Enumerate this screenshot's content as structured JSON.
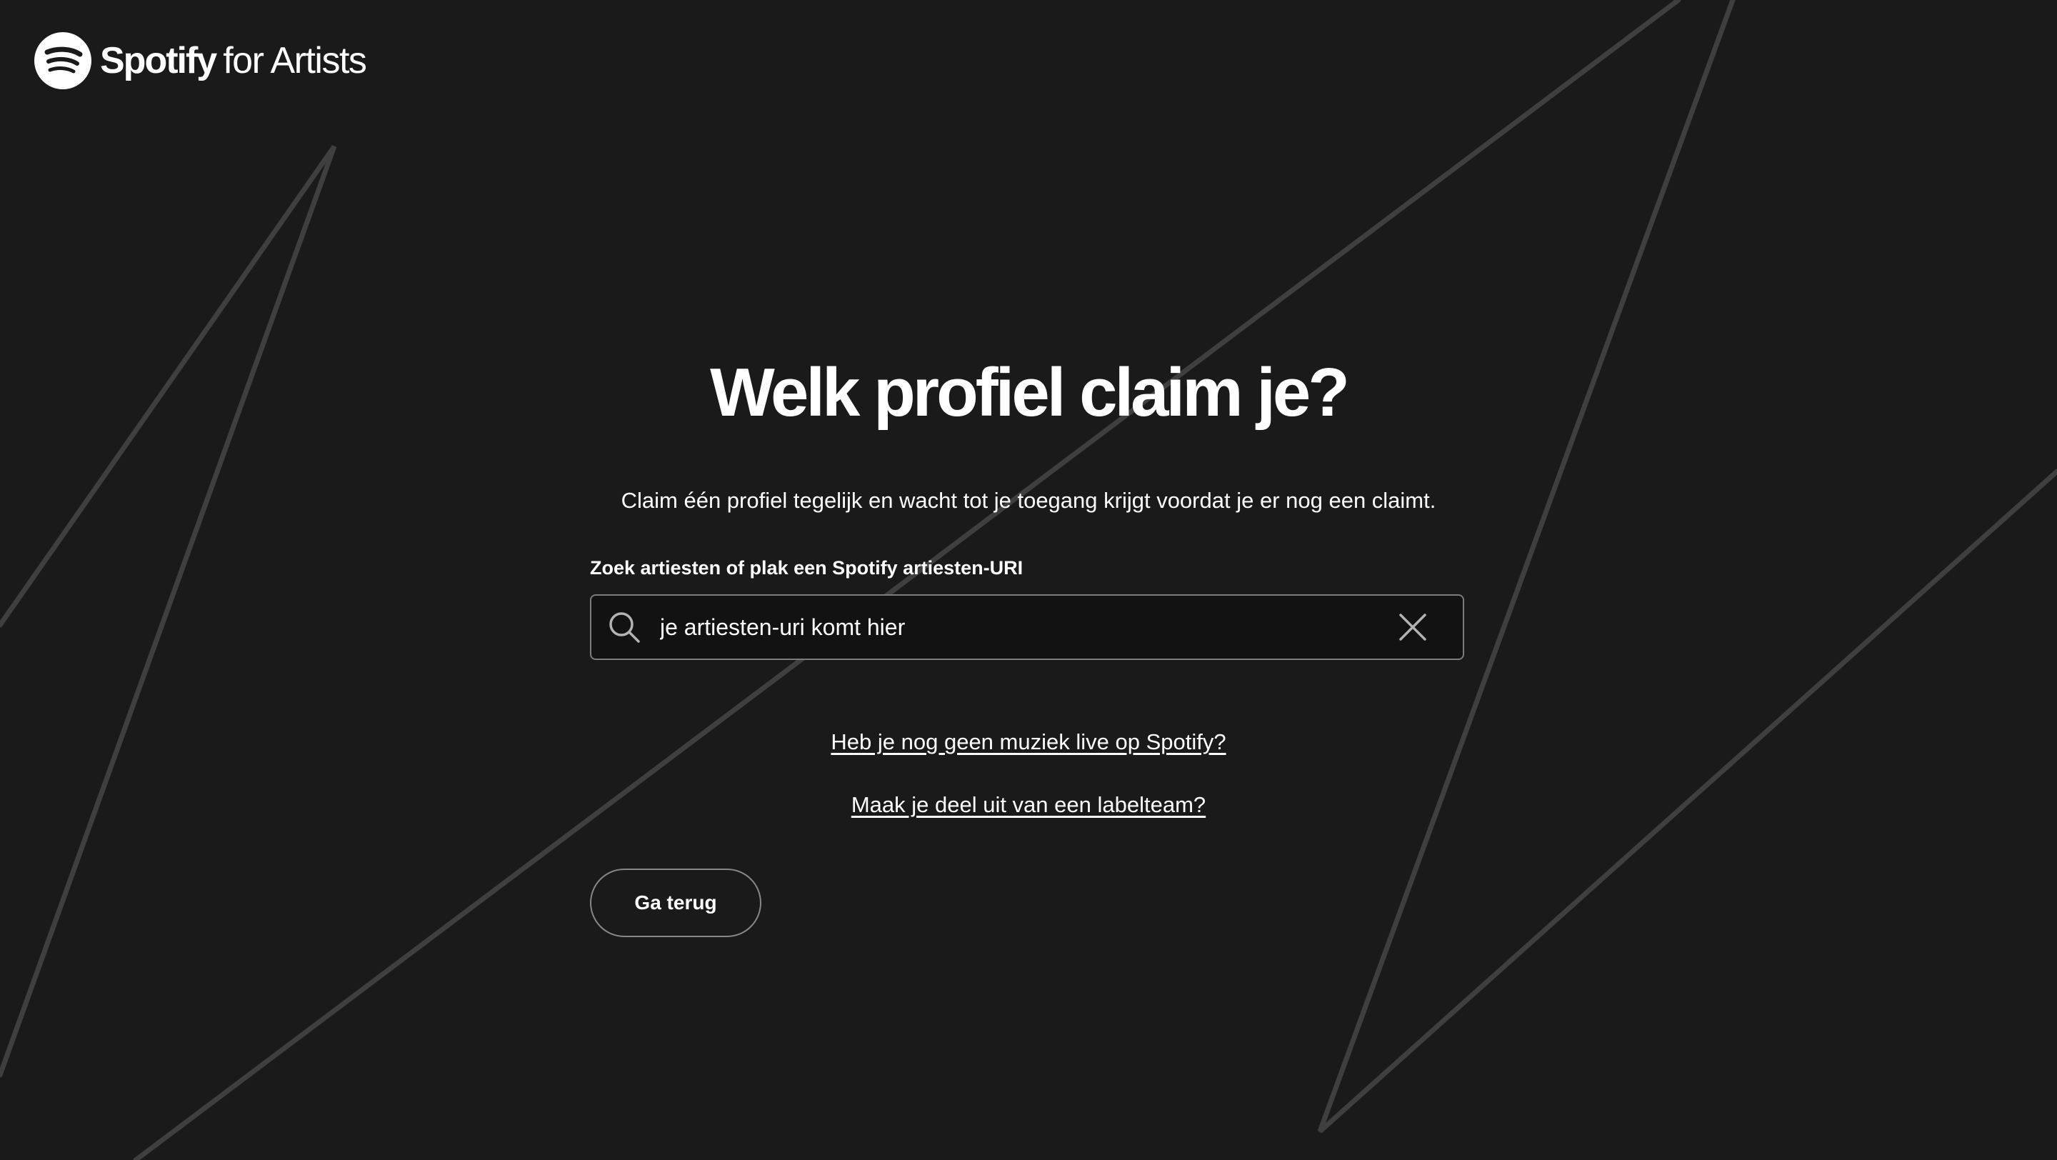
{
  "header": {
    "logo": {
      "brand": "Spotify",
      "sub": "for Artists",
      "icon": "spotify-logo-icon"
    }
  },
  "main": {
    "title": "Welk profiel claim je?",
    "subtitle": "Claim één profiel tegelijk en wacht tot je toegang krijgt voordat je er nog een claimt.",
    "search": {
      "label": "Zoek artiesten of plak een Spotify artiesten-URI",
      "value": "je artiesten-uri komt hier",
      "placeholder": "",
      "search_icon": "search-icon",
      "clear_icon": "close-icon"
    },
    "links": [
      {
        "label": "Heb je nog geen muziek live op Spotify?"
      },
      {
        "label": "Maak je deel uit van een labelteam?"
      }
    ],
    "back_button": {
      "label": "Ga terug"
    }
  },
  "colors": {
    "background": "#1a1a1a",
    "text": "#ffffff",
    "input_border": "#7c7c7c",
    "input_background": "#121212",
    "decorative_lines": "#3f3f3f"
  }
}
